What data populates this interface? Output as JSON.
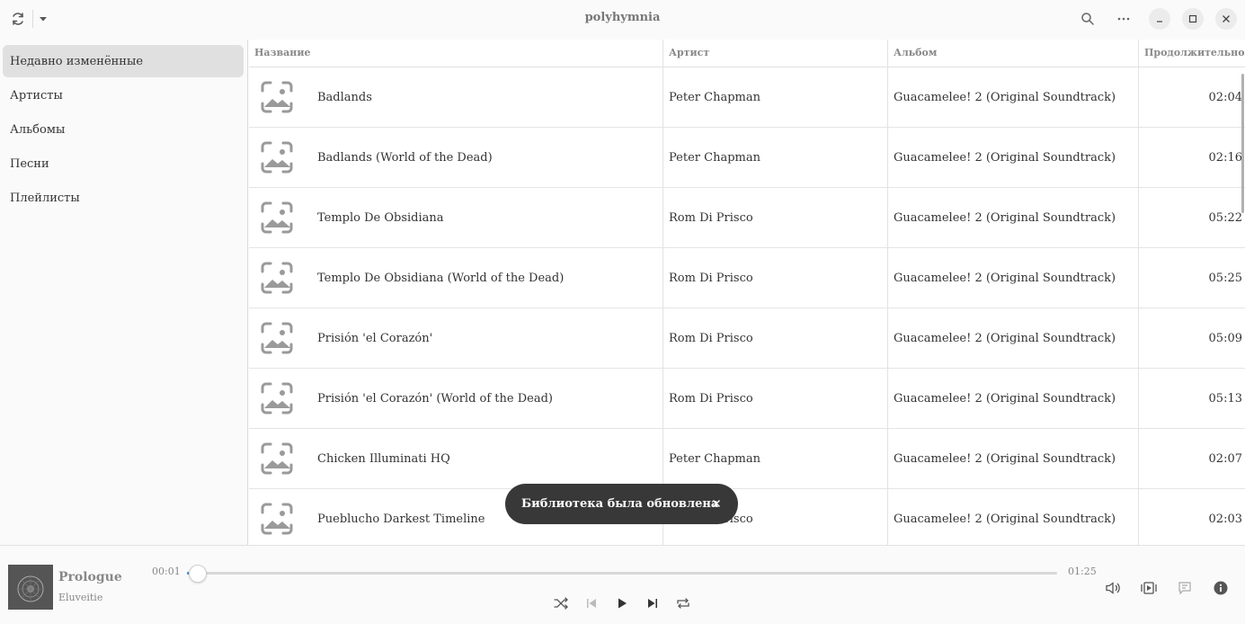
{
  "window": {
    "title": "polyhymnia"
  },
  "sidebar": {
    "items": [
      {
        "label": "Недавно изменённые",
        "active": true
      },
      {
        "label": "Артисты"
      },
      {
        "label": "Альбомы"
      },
      {
        "label": "Песни"
      },
      {
        "label": "Плейлисты"
      }
    ]
  },
  "table": {
    "columns": {
      "title": "Название",
      "artist": "Артист",
      "album": "Альбом",
      "duration": "Продолжительность"
    },
    "rows": [
      {
        "title": "Badlands",
        "artist": "Peter Chapman",
        "album": "Guacamelee! 2 (Original Soundtrack)",
        "duration": "02:04"
      },
      {
        "title": "Badlands (World of the Dead)",
        "artist": "Peter Chapman",
        "album": "Guacamelee! 2 (Original Soundtrack)",
        "duration": "02:16"
      },
      {
        "title": "Templo De Obsidiana",
        "artist": "Rom Di Prisco",
        "album": "Guacamelee! 2 (Original Soundtrack)",
        "duration": "05:22"
      },
      {
        "title": "Templo De Obsidiana (World of the Dead)",
        "artist": "Rom Di Prisco",
        "album": "Guacamelee! 2 (Original Soundtrack)",
        "duration": "05:25"
      },
      {
        "title": "Prisión 'el Corazón'",
        "artist": "Rom Di Prisco",
        "album": "Guacamelee! 2 (Original Soundtrack)",
        "duration": "05:09"
      },
      {
        "title": "Prisión 'el Corazón' (World of the Dead)",
        "artist": "Rom Di Prisco",
        "album": "Guacamelee! 2 (Original Soundtrack)",
        "duration": "05:13"
      },
      {
        "title": "Chicken Illuminati HQ",
        "artist": "Peter Chapman",
        "album": "Guacamelee! 2 (Original Soundtrack)",
        "duration": "02:07"
      },
      {
        "title": "Pueblucho Darkest Timeline",
        "artist": "Rom Di Prisco",
        "album": "Guacamelee! 2 (Original Soundtrack)",
        "duration": "02:03"
      }
    ]
  },
  "toast": {
    "message": "Библиотека была обновлена"
  },
  "player": {
    "title": "Prologue",
    "artist": "Eluveitie",
    "cover_text": "ELUVEITIE",
    "elapsed": "00:01",
    "total": "01:25",
    "progress": 0.012
  },
  "colors": {
    "accent": "#3584e4",
    "toast_bg": "#383838",
    "sidebar_active": "#e0e0e0"
  },
  "icons": {
    "headerbar": [
      "refresh-icon",
      "dropdown-arrow-icon",
      "search-icon",
      "menu-dots-icon",
      "minimize-icon",
      "maximize-icon",
      "close-icon"
    ],
    "player": [
      "shuffle-icon",
      "previous-icon",
      "play-icon",
      "next-icon",
      "repeat-icon",
      "volume-icon",
      "queue-icon",
      "lyrics-icon",
      "info-icon"
    ],
    "row": "image-placeholder-icon"
  }
}
